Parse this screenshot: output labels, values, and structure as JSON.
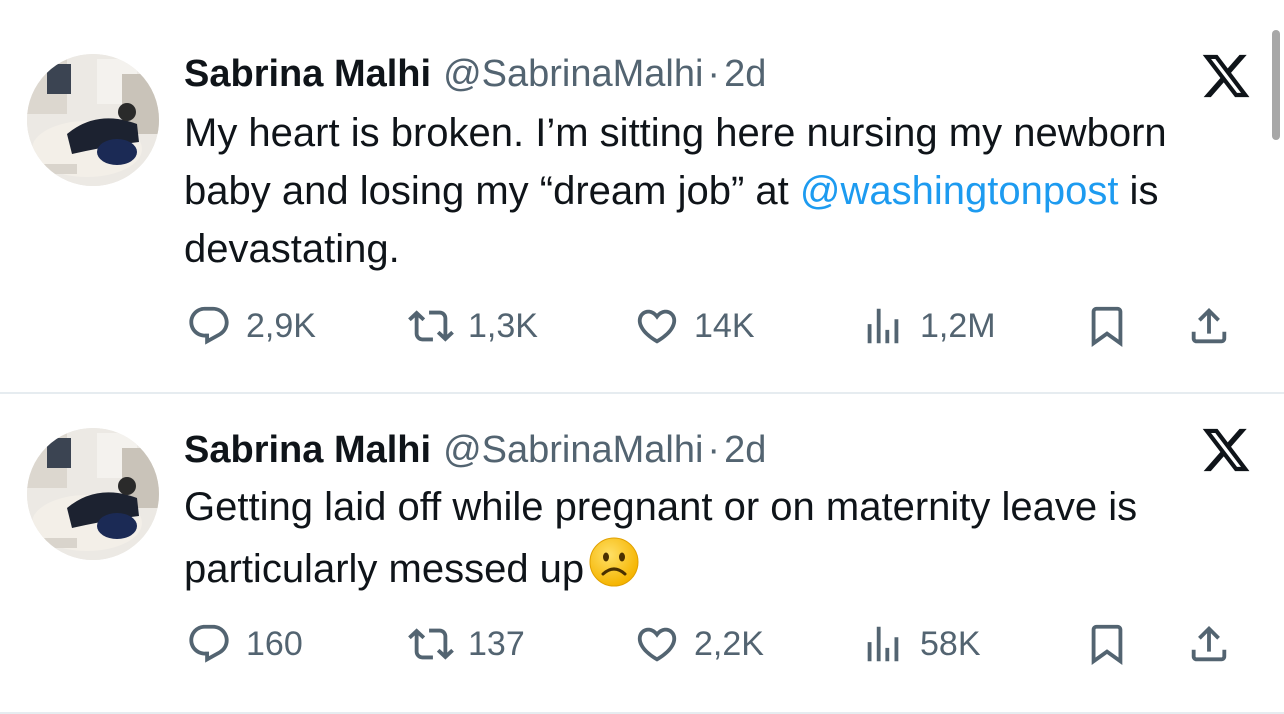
{
  "tweets": [
    {
      "author_name": "Sabrina Malhi",
      "handle": "@SabrinaMalhi",
      "separator": "·",
      "time": "2d",
      "text_parts": [
        "My heart is broken. I’m sitting here nursing my newborn baby and losing my “dream job” at ",
        "@washingtonpost",
        " is devastating."
      ],
      "stats": {
        "replies": "2,9K",
        "reposts": "1,3K",
        "likes": "14K",
        "views": "1,2M"
      }
    },
    {
      "author_name": "Sabrina Malhi",
      "handle": "@SabrinaMalhi",
      "separator": "·",
      "time": "2d",
      "text": "Getting laid off while pregnant or on maternity leave is particularly messed up",
      "emoji": "frowning-face",
      "stats": {
        "replies": "160",
        "reposts": "137",
        "likes": "2,2K",
        "views": "58K"
      }
    }
  ],
  "icons": [
    "reply-icon",
    "repost-icon",
    "like-icon",
    "views-icon",
    "bookmark-icon",
    "share-icon",
    "x-logo-icon"
  ],
  "colors": {
    "text": "#0f1419",
    "secondary": "#536471",
    "link": "#1d9bf0",
    "divider": "#e6ecf0"
  }
}
